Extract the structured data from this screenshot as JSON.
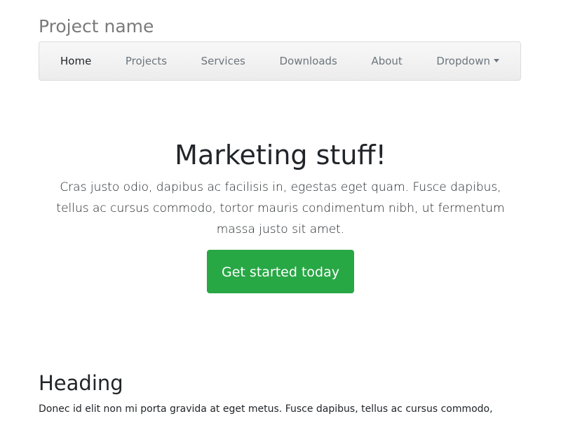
{
  "header": {
    "title": "Project name"
  },
  "nav": {
    "items": [
      {
        "label": "Home"
      },
      {
        "label": "Projects"
      },
      {
        "label": "Services"
      },
      {
        "label": "Downloads"
      },
      {
        "label": "About"
      },
      {
        "label": "Dropdown"
      }
    ]
  },
  "hero": {
    "heading": "Marketing stuff!",
    "lead": "Cras justo odio, dapibus ac facilisis in, egestas eget quam. Fusce dapibus, tellus ac cursus commodo, tortor mauris condimentum nibh, ut fermentum massa justo sit amet.",
    "cta_label": "Get started today",
    "cta_color": "#28a745"
  },
  "section": {
    "heading": "Heading",
    "text": "Donec id elit non mi porta gravida at eget metus. Fusce dapibus, tellus ac cursus commodo,"
  }
}
